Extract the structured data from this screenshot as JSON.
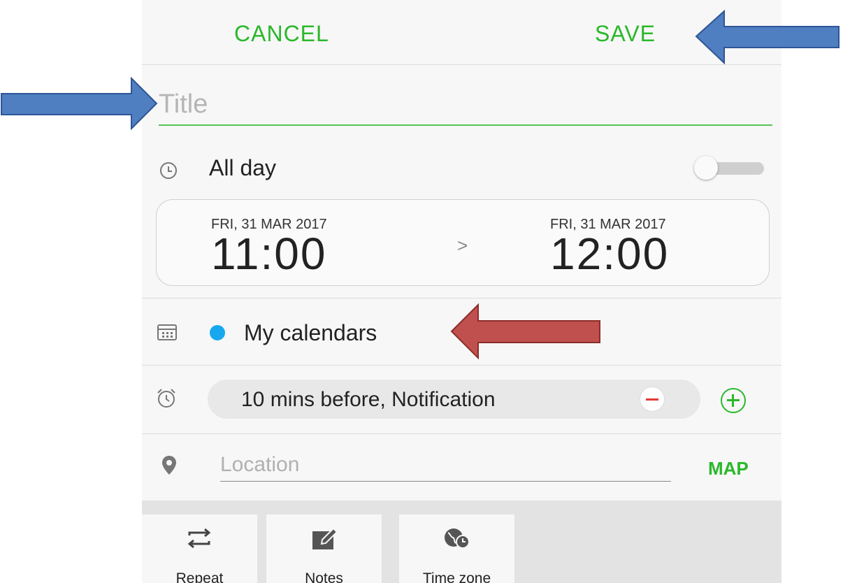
{
  "header": {
    "cancel_label": "CANCEL",
    "save_label": "SAVE"
  },
  "title_field": {
    "placeholder": "Title",
    "value": ""
  },
  "all_day": {
    "label": "All day",
    "enabled": false
  },
  "time_range": {
    "start_date": "FRI, 31 MAR 2017",
    "start_time": "11:00",
    "separator": ">",
    "end_date": "FRI, 31 MAR 2017",
    "end_time": "12:00"
  },
  "calendar": {
    "label": "My calendars",
    "color": "#18a8f0"
  },
  "reminder": {
    "label": "10 mins before, Notification"
  },
  "location": {
    "placeholder": "Location",
    "value": "",
    "map_label": "MAP"
  },
  "bottom_options": [
    {
      "label": "Repeat",
      "icon": "repeat-icon"
    },
    {
      "label": "Notes",
      "icon": "notes-icon"
    },
    {
      "label": "Time zone",
      "icon": "time-zone-icon"
    }
  ],
  "colors": {
    "accent": "#2ab82a",
    "callout_blue": "#4f7fc0",
    "callout_red": "#c0504d"
  }
}
